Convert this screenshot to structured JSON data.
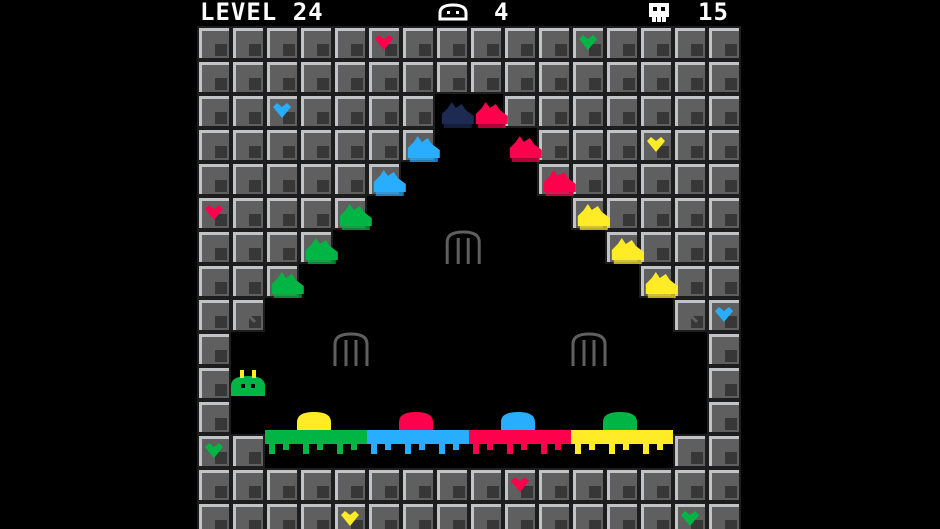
{
  "hud": {
    "level_label": "LEVEL 24",
    "blob_icon": "blob-icon",
    "blobs_remaining": "4",
    "skull_icon": "skull-icon",
    "deaths": "15"
  },
  "colors": {
    "background": "#000000",
    "brick": "#5f5f5f",
    "brick_highlight": "#c2c3c7",
    "brick_shadow": "#1d1d1d",
    "slime_green": "#00b543",
    "slime_blue": "#29adff",
    "slime_pink": "#ff004d",
    "slime_yellow": "#ffec27",
    "slime_dark_blue": "#1d2b53",
    "slime_orange": "#ffa300"
  },
  "entities": {
    "player": "green-slime-player",
    "doors": [
      "door-icon",
      "door-icon",
      "door-icon"
    ],
    "goal_blobs": [
      "yellow",
      "pink",
      "blue",
      "green"
    ],
    "wall_hearts": [
      "pink",
      "green",
      "blue",
      "yellow",
      "pink",
      "blue",
      "green",
      "pink",
      "yellow",
      "green"
    ]
  }
}
